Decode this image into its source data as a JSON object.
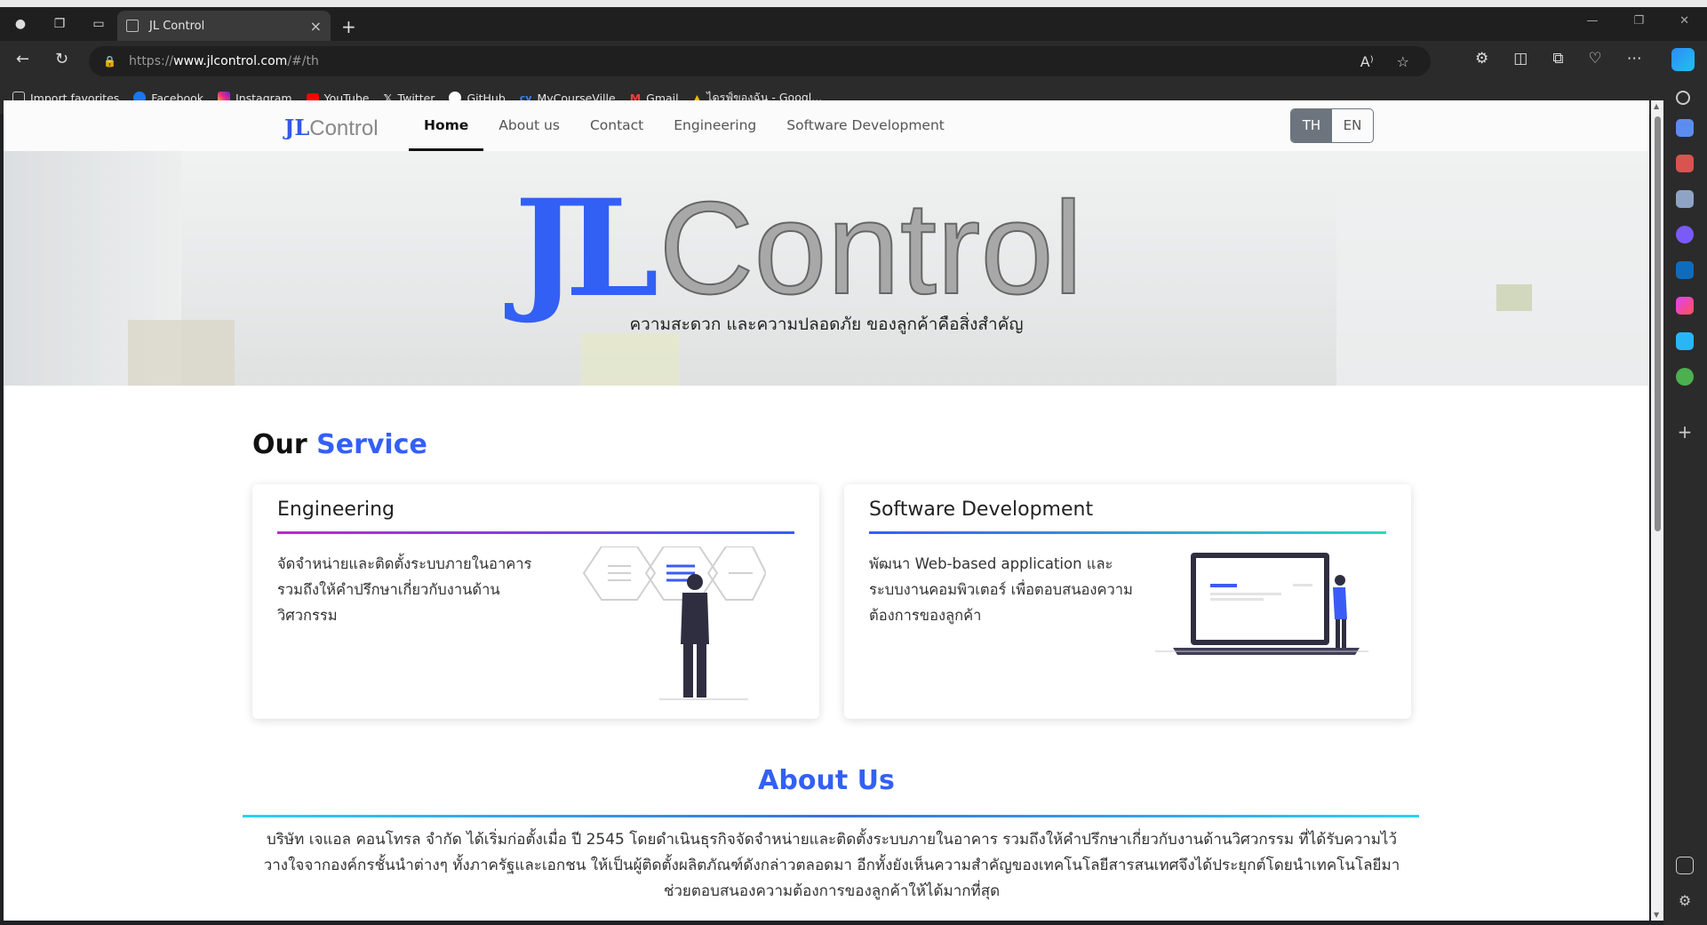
{
  "browser": {
    "tab_title": "JL Control",
    "url_protocol": "https://",
    "url_host": "www.jlcontrol.com",
    "url_path": "/#/th",
    "bookmarks": [
      {
        "label": "Import favorites",
        "icon": "import-icon",
        "color": "#cccccc"
      },
      {
        "label": "Facebook",
        "icon": "facebook-icon",
        "color": "#1877f2"
      },
      {
        "label": "Instagram",
        "icon": "instagram-icon",
        "color": "#e1306c"
      },
      {
        "label": "YouTube",
        "icon": "youtube-icon",
        "color": "#ff0000"
      },
      {
        "label": "Twitter",
        "icon": "x-icon",
        "color": "#000000"
      },
      {
        "label": "GitHub",
        "icon": "github-icon",
        "color": "#ffffff"
      },
      {
        "label": "MyCourseVille",
        "icon": "mycourseville-icon",
        "color": "#3b82f6"
      },
      {
        "label": "Gmail",
        "icon": "gmail-icon",
        "color": "#ea4335"
      },
      {
        "label": "ไดรฟ์ของฉัน - Googl...",
        "icon": "google-drive-icon",
        "color": "#34a853"
      }
    ]
  },
  "site": {
    "logo_jl": "JL",
    "logo_control": "Control",
    "nav": [
      {
        "label": "Home",
        "active": true
      },
      {
        "label": "About us",
        "active": false
      },
      {
        "label": "Contact",
        "active": false
      },
      {
        "label": "Engineering",
        "active": false
      },
      {
        "label": "Software Development",
        "active": false
      }
    ],
    "lang": {
      "th": "TH",
      "en": "EN",
      "active": "TH"
    }
  },
  "hero": {
    "logo_jl": "JL",
    "logo_control": "Control",
    "tagline": "ความสะดวก และความปลอดภัย ของลูกค้าคือสิ่งสำคัญ"
  },
  "services": {
    "title_our": "Our",
    "title_service": "Service",
    "cards": [
      {
        "title": "Engineering",
        "text": "จัดจำหน่ายและติดตั้งระบบภายในอาคาร รวมถึงให้คำปรึกษาเกี่ยวกับงานด้านวิศวกรรม",
        "bar_from": "#c026d3",
        "bar_to": "#3b5bf6"
      },
      {
        "title": "Software Development",
        "text": "พัฒนา Web-based application และระบบงานคอมพิวเตอร์ เพื่อตอบสนองความต้องการของลูกค้า",
        "bar_from": "#3b5bf6",
        "bar_to": "#2bd9c0"
      }
    ]
  },
  "about": {
    "title": "About Us",
    "text": "บริษัท เจแอล คอนโทรล จำกัด ได้เริ่มก่อตั้งเมื่อ ปี 2545 โดยดำเนินธุรกิจจัดจำหน่ายและติดตั้งระบบภายในอาคาร รวมถึงให้คำปรึกษาเกี่ยวกับงานด้านวิศวกรรม ที่ได้รับความไว้วางใจจากองค์กรชั้นนำต่างๆ ทั้งภาครัฐและเอกชน ให้เป็นผู้ติดตั้งผลิตภัณฑ์ดังกล่าวตลอดมา อีกทั้งยังเห็นความสำคัญของเทคโนโลยีสารสนเทศจึงได้ประยุกต์โดยนำเทคโนโลยีมาช่วยตอบสนองความต้องการของลูกค้าให้ได้มากที่สุด"
  },
  "colors": {
    "brand_blue": "#3360f4",
    "lang_active": "#6c757d"
  }
}
